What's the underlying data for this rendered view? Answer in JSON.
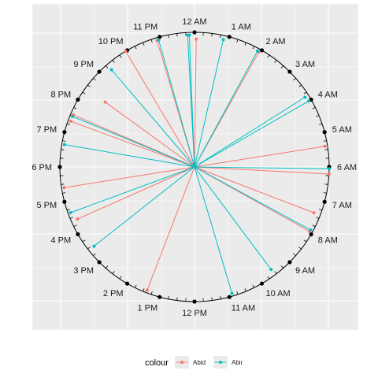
{
  "chart_data": {
    "type": "radial-line",
    "hour_labels": [
      "12 AM",
      "1 AM",
      "2 AM",
      "3 AM",
      "4 AM",
      "5 AM",
      "6 AM",
      "7 AM",
      "8 AM",
      "9 AM",
      "10 AM",
      "11 AM",
      "12 PM",
      "1 PM",
      "2 PM",
      "3 PM",
      "4 PM",
      "5 PM",
      "6 PM",
      "7 PM",
      "8 PM",
      "9 PM",
      "10 PM",
      "11 PM"
    ],
    "legend": {
      "title": "colour",
      "position": "bottom"
    },
    "series": [
      {
        "name": "Abid",
        "color": "#F8766D",
        "points": [
          {
            "hour": 0.05,
            "r": 0.95
          },
          {
            "hour": 1.95,
            "r": 0.98
          },
          {
            "hour": 5.4,
            "r": 0.98
          },
          {
            "hour": 6.2,
            "r": 1.0
          },
          {
            "hour": 7.4,
            "r": 0.95
          },
          {
            "hour": 7.95,
            "r": 0.98
          },
          {
            "hour": 13.4,
            "r": 0.98
          },
          {
            "hour": 16.4,
            "r": 0.95
          },
          {
            "hour": 17.4,
            "r": 0.98
          },
          {
            "hour": 19.35,
            "r": 0.98
          },
          {
            "hour": 19.55,
            "r": 0.98
          },
          {
            "hour": 20.4,
            "r": 0.82
          },
          {
            "hour": 21.95,
            "r": 1.0
          },
          {
            "hour": 22.9,
            "r": 0.98
          }
        ]
      },
      {
        "name": "Abir",
        "color": "#00BFC4",
        "points": [
          {
            "hour": 23.8,
            "r": 0.98
          },
          {
            "hour": 0.85,
            "r": 0.97
          },
          {
            "hour": 1.9,
            "r": 0.98
          },
          {
            "hour": 3.85,
            "r": 0.97
          },
          {
            "hour": 4.0,
            "r": 0.98
          },
          {
            "hour": 6.05,
            "r": 1.0
          },
          {
            "hour": 7.9,
            "r": 0.98
          },
          {
            "hour": 9.55,
            "r": 0.95
          },
          {
            "hour": 10.9,
            "r": 0.98
          },
          {
            "hour": 15.45,
            "r": 0.95
          },
          {
            "hour": 16.65,
            "r": 0.98
          },
          {
            "hour": 18.65,
            "r": 0.98
          },
          {
            "hour": 19.5,
            "r": 0.98
          },
          {
            "hour": 21.3,
            "r": 0.95
          },
          {
            "hour": 22.95,
            "r": 0.98
          },
          {
            "hour": 23.85,
            "r": 0.98
          }
        ]
      }
    ]
  }
}
